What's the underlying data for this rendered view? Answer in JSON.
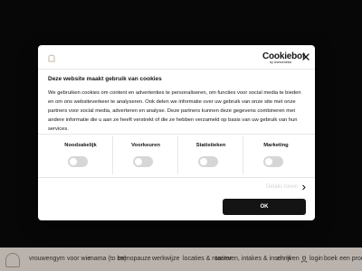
{
  "nav": {
    "items": [
      "vrouwengym",
      "voor wie",
      "mama (to be)",
      "menopauze",
      "werkwijze",
      "locaties & rooster",
      "tarieven, intakes & inschrijven",
      "en",
      "nl"
    ],
    "login": "login",
    "book": "boek een proefles"
  },
  "dialog": {
    "title": "Deze website maakt gebruik van cookies",
    "body": "We gebruiken cookies om content en advertenties te personaliseren, om functies voor social media te bieden en om ons websiteverkeer te analyseren. Ook delen we informatie over uw gebruik van onze site met onze partners voor social media, adverteren en analyse. Deze partners kunnen deze gegevens combineren met andere informatie die u aan ze heeft verstrekt of die ze hebben verzameld op basis van uw gebruik van hun services.",
    "logo_text": "Cookiebot",
    "logo_sub": "by Usercentrics",
    "toggles": [
      {
        "label": "Noodzakelijk"
      },
      {
        "label": "Voorkeuren"
      },
      {
        "label": "Statistieken"
      },
      {
        "label": "Marketing"
      }
    ],
    "details_label": "Details tonen",
    "ok_label": "OK"
  },
  "colors": {
    "brand_accent": "#b69c86",
    "nav_background": "#efe6de",
    "ok_button": "#141414",
    "toggle_off": "#d6d6d6"
  }
}
